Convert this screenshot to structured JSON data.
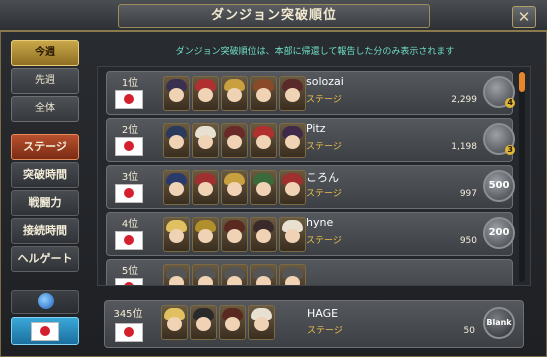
{
  "window": {
    "title": "ダンジョン突破順位",
    "close_label": "✕"
  },
  "notice": "ダンジョン突破順位は、本部に帰還して報告した分のみ表示されます",
  "period_tabs": [
    {
      "label": "今週",
      "active": true
    },
    {
      "label": "先週",
      "active": false
    },
    {
      "label": "全体",
      "active": false
    }
  ],
  "category_buttons": [
    {
      "label": "ステージ",
      "active": true
    },
    {
      "label": "突破時間",
      "active": false
    },
    {
      "label": "戦闘力",
      "active": false
    },
    {
      "label": "接続時間",
      "active": false
    },
    {
      "label": "ヘルゲート",
      "active": false
    }
  ],
  "region_buttons": [
    {
      "name": "global",
      "icon": "globe-icon"
    },
    {
      "name": "japan",
      "icon": "japan-flag-icon"
    }
  ],
  "rankings": [
    {
      "rank": "1位",
      "flag": "japan-flag-icon",
      "name": "solozai",
      "stage_label": "ステージ",
      "score": "2,299",
      "badge": "",
      "badge_num": "4",
      "avatars": [
        "#3a3050",
        "#b03030",
        "#c8a040",
        "#8a4a2a",
        "#5a2a2a"
      ]
    },
    {
      "rank": "2位",
      "flag": "japan-flag-icon",
      "name": "Pitz",
      "stage_label": "ステージ",
      "score": "1,198",
      "badge": "",
      "badge_num": "3",
      "avatars": [
        "#2a3a5a",
        "#e8e0d0",
        "#6a2a2a",
        "#b03030",
        "#402a4a"
      ]
    },
    {
      "rank": "3位",
      "flag": "japan-flag-icon",
      "name": "ころん",
      "stage_label": "ステージ",
      "score": "997",
      "badge": "500",
      "badge_num": "",
      "avatars": [
        "#2a3a6a",
        "#a03030",
        "#c8a040",
        "#3a6a3a",
        "#a03030"
      ]
    },
    {
      "rank": "4位",
      "flag": "japan-flag-icon",
      "name": "hyne",
      "stage_label": "ステージ",
      "score": "950",
      "badge": "200",
      "badge_num": "",
      "avatars": [
        "#e0c060",
        "#b0902a",
        "#5a2a20",
        "#3a2a2a",
        "#e8e0d0"
      ]
    },
    {
      "rank": "5位",
      "flag": "japan-flag-icon",
      "name": "",
      "stage_label": "",
      "score": "",
      "badge": "",
      "badge_num": "",
      "avatars": [
        "#555",
        "#555",
        "#555",
        "#555",
        "#555"
      ]
    }
  ],
  "my_rank": {
    "rank": "345位",
    "flag": "japan-flag-icon",
    "name": "HAGE",
    "stage_label": "ステージ",
    "score": "50",
    "badge": "Blank",
    "avatars": [
      "#e0c060",
      "#2a2a2a",
      "#5a2a20",
      "#e8e0d0"
    ]
  },
  "colors": {
    "accent_gold": "#c9a84a",
    "active_red": "#b8502e",
    "notice_teal": "#6fe0c8",
    "stage_yellow": "#f0c04a",
    "scroll_orange": "#e8862a"
  }
}
